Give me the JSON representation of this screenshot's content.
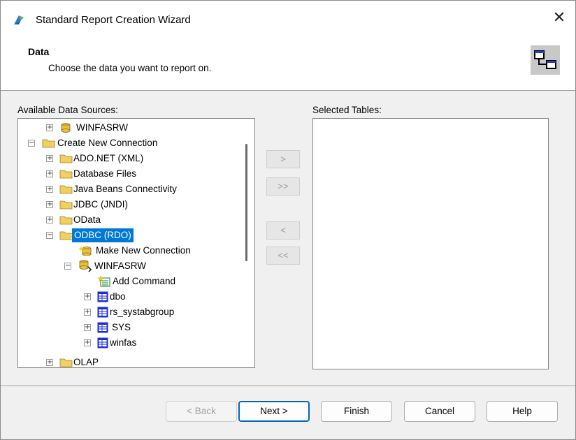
{
  "window": {
    "title": "Standard Report Creation Wizard",
    "close_glyph": "✕"
  },
  "header": {
    "title": "Data",
    "subtitle": "Choose the data you want to report on."
  },
  "available": {
    "label": "Available Data Sources:",
    "tree": [
      {
        "label": "WINFASRW",
        "expander": "+",
        "icon": "database-icon"
      },
      {
        "label": "Create New Connection",
        "expander": "−",
        "icon": "folder-icon"
      },
      {
        "label": "ADO.NET (XML)",
        "expander": "+",
        "icon": "folder-icon"
      },
      {
        "label": "Database Files",
        "expander": "+",
        "icon": "folder-icon"
      },
      {
        "label": "Java Beans Connectivity",
        "expander": "+",
        "icon": "folder-icon"
      },
      {
        "label": "JDBC (JNDI)",
        "expander": "+",
        "icon": "folder-icon"
      },
      {
        "label": "OData",
        "expander": "+",
        "icon": "folder-icon"
      },
      {
        "label": "ODBC (RDO)",
        "expander": "−",
        "icon": "folder-icon",
        "selected": true
      },
      {
        "label": "Make New Connection",
        "expander": "",
        "icon": "new-connection-icon"
      },
      {
        "label": "WINFASRW",
        "expander": "−",
        "icon": "connected-database-icon"
      },
      {
        "label": "Add Command",
        "expander": "",
        "icon": "add-command-icon"
      },
      {
        "label": "dbo",
        "expander": "+",
        "icon": "table-owner-icon"
      },
      {
        "label": "rs_systabgroup",
        "expander": "+",
        "icon": "table-owner-icon"
      },
      {
        "label": "SYS",
        "expander": "+",
        "icon": "table-owner-icon"
      },
      {
        "label": "winfas",
        "expander": "+",
        "icon": "table-owner-icon"
      },
      {
        "label": "OLAP",
        "expander": "+",
        "icon": "folder-icon"
      }
    ]
  },
  "selected": {
    "label": "Selected Tables:"
  },
  "transfer": {
    "add": ">",
    "add_all": ">>",
    "remove": "<",
    "remove_all": "<<"
  },
  "buttons": {
    "back": "< Back",
    "next": "Next >",
    "finish": "Finish",
    "cancel": "Cancel",
    "help": "Help"
  },
  "colors": {
    "selection": "#0078d7",
    "folder": "#f0d060",
    "default_button_border": "#0067c0"
  }
}
